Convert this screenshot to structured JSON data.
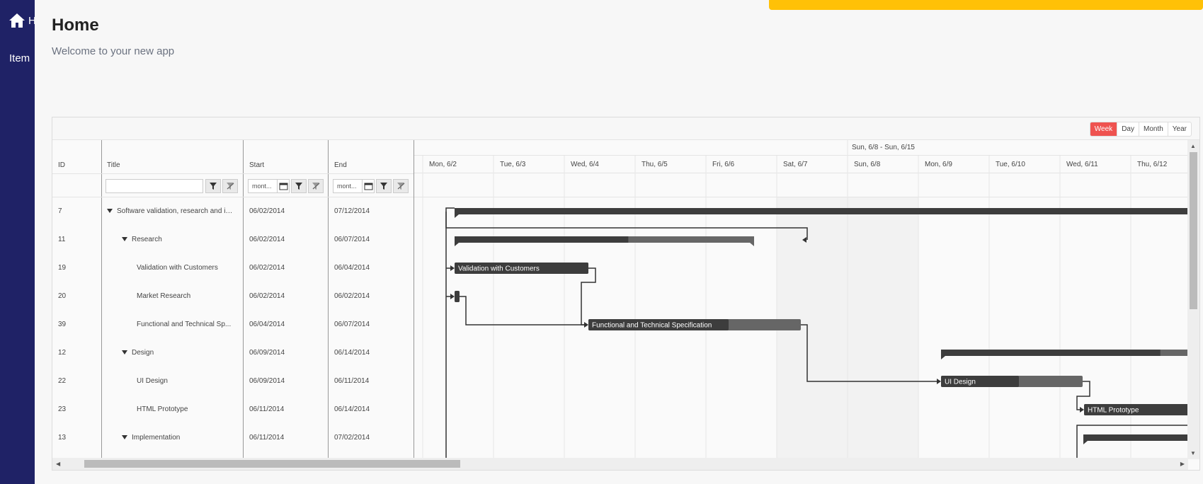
{
  "sidebar": {
    "home_label": "Home",
    "item_label": "Item"
  },
  "header": {
    "title": "Home",
    "subtitle": "Welcome to your new app"
  },
  "gantt": {
    "views": [
      {
        "label": "Week",
        "active": true
      },
      {
        "label": "Day",
        "active": false
      },
      {
        "label": "Month",
        "active": false
      },
      {
        "label": "Year",
        "active": false
      }
    ],
    "columns": {
      "id": "ID",
      "title": "Title",
      "start": "Start",
      "end": "End"
    },
    "filters": {
      "title_value": "",
      "start_value": "mont...",
      "end_value": "mont..."
    },
    "week_label": "Sun, 6/8 - Sun, 6/15",
    "days": [
      "Mon, 6/2",
      "Tue, 6/3",
      "Wed, 6/4",
      "Thu, 6/5",
      "Fri, 6/6",
      "Sat, 6/7",
      "Sun, 6/8",
      "Mon, 6/9",
      "Tue, 6/10",
      "Wed, 6/11",
      "Thu, 6/12"
    ],
    "rows": [
      {
        "id": "7",
        "title": "Software validation, research and imp...",
        "start": "06/02/2014",
        "end": "07/12/2014",
        "level": 0,
        "expanded": true,
        "summary": true
      },
      {
        "id": "11",
        "title": "Research",
        "start": "06/02/2014",
        "end": "06/07/2014",
        "level": 1,
        "expanded": true,
        "summary": true
      },
      {
        "id": "19",
        "title": "Validation with Customers",
        "start": "06/02/2014",
        "end": "06/04/2014",
        "level": 2,
        "summary": false
      },
      {
        "id": "20",
        "title": "Market Research",
        "start": "06/02/2014",
        "end": "06/02/2014",
        "level": 2,
        "summary": false
      },
      {
        "id": "39",
        "title": "Functional and Technical Sp...",
        "start": "06/04/2014",
        "end": "06/07/2014",
        "level": 2,
        "summary": false
      },
      {
        "id": "12",
        "title": "Design",
        "start": "06/09/2014",
        "end": "06/14/2014",
        "level": 1,
        "expanded": true,
        "summary": true
      },
      {
        "id": "22",
        "title": "UI Design",
        "start": "06/09/2014",
        "end": "06/11/2014",
        "level": 2,
        "summary": false
      },
      {
        "id": "23",
        "title": "HTML Prototype",
        "start": "06/11/2014",
        "end": "06/14/2014",
        "level": 2,
        "summary": false
      },
      {
        "id": "13",
        "title": "Implementation",
        "start": "06/11/2014",
        "end": "07/02/2014",
        "level": 1,
        "expanded": true,
        "summary": true
      }
    ],
    "bars": [
      {
        "row": 2,
        "label": "Validation with Customers",
        "progress": 1.0
      },
      {
        "row": 3,
        "label": "",
        "progress": 1.0
      },
      {
        "row": 4,
        "label": "Functional and Technical Specification",
        "progress": 0.66
      },
      {
        "row": 6,
        "label": "UI Design",
        "progress": 0.55
      },
      {
        "row": 7,
        "label": "HTML Prototype",
        "progress": 1.0
      }
    ],
    "summaries": [
      {
        "row": 0,
        "progress": 1.0
      },
      {
        "row": 1,
        "progress": 0.58
      },
      {
        "row": 5,
        "progress": 0.87
      },
      {
        "row": 8,
        "progress": 1.0
      }
    ],
    "colors": {
      "accent": "#ef5350",
      "bar_done": "#3d3d3d",
      "bar_todo": "#666666",
      "sidebar": "#1f2266",
      "toast": "#ffc107"
    }
  }
}
